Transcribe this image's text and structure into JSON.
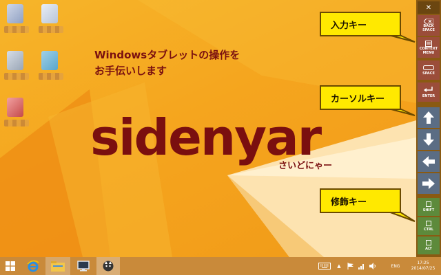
{
  "headline": {
    "line1": "Windowsタブレットの操作を",
    "line2": "お手伝いします"
  },
  "logo": {
    "name": "sidenyar",
    "reading": "さいどにゃー"
  },
  "callouts": {
    "input_keys": "入力キー",
    "cursor_keys": "カーソルキー",
    "modifier_keys": "修飾キー"
  },
  "sidebar": {
    "close_glyph": "✕",
    "backspace": [
      "BACK",
      "SPACE"
    ],
    "context_menu": [
      "CONTEXT",
      "MENU"
    ],
    "space": "SPACE",
    "enter": "ENTER",
    "shift": "SHIFT",
    "ctrl": "CTRL",
    "alt": "ALT"
  },
  "taskbar": {
    "language": "ENG",
    "time": "17:25",
    "date": "2014/07/25"
  },
  "colors": {
    "accent_dark_red": "#7a0f0f",
    "callout_yellow": "#ffe900",
    "sidebar_bg": "#8a5a12",
    "taskbar_bg": "#c98a3a"
  },
  "icons": [
    "windows-start-icon",
    "ie-icon",
    "file-explorer-icon",
    "display-icon",
    "sidenyar-app-icon",
    "keyboard-icon",
    "chevron-up-icon",
    "flag-icon",
    "network-icon",
    "volume-icon"
  ]
}
